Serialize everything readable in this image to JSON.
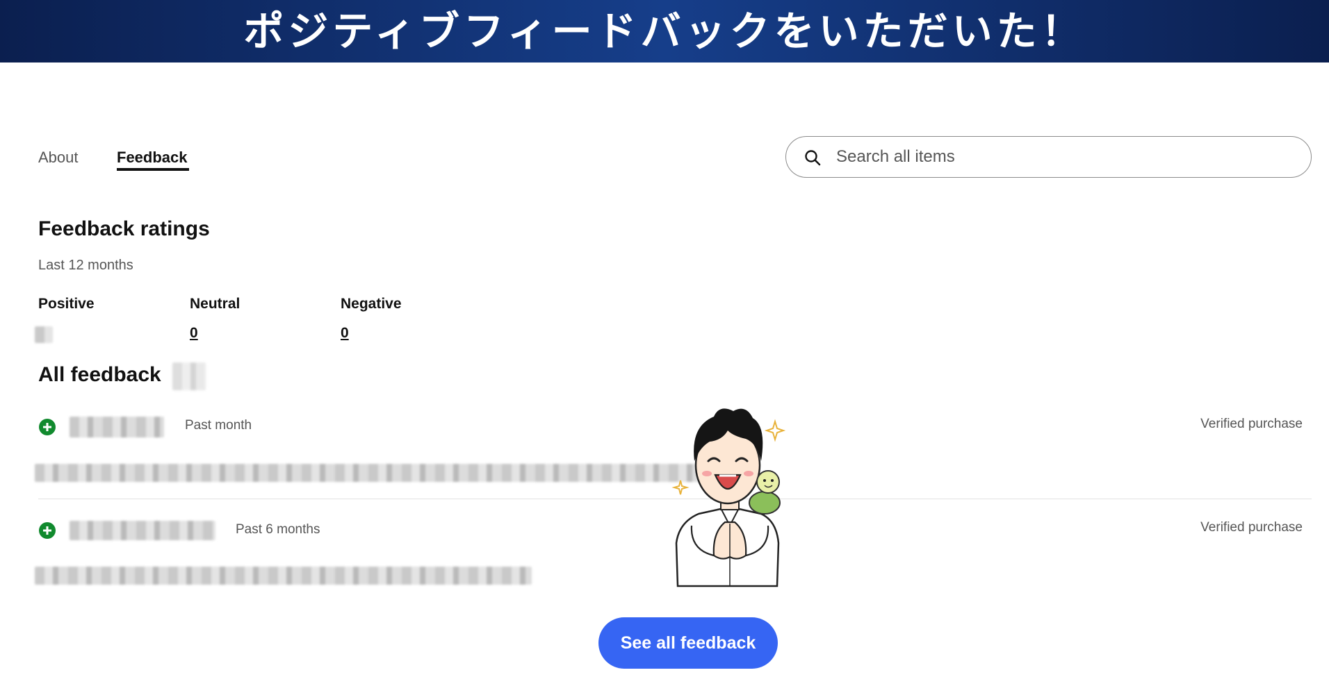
{
  "banner": {
    "title": "ポジティブフィードバックをいただいた！"
  },
  "tabs": [
    {
      "label": "About",
      "active": false
    },
    {
      "label": "Feedback",
      "active": true
    }
  ],
  "search": {
    "placeholder": "Search all items",
    "value": ""
  },
  "ratings": {
    "title": "Feedback ratings",
    "period": "Last 12 months",
    "positive": {
      "label": "Positive",
      "value": ""
    },
    "neutral": {
      "label": "Neutral",
      "value": "0"
    },
    "negative": {
      "label": "Negative",
      "value": "0"
    }
  },
  "all_feedback": {
    "title": "All feedback",
    "entries": [
      {
        "rating": "positive",
        "time": "Past month",
        "badge": "Verified purchase"
      },
      {
        "rating": "positive",
        "time": "Past 6 months",
        "badge": "Verified purchase"
      }
    ]
  },
  "see_all_button": {
    "label": "See all feedback"
  },
  "colors": {
    "accent": "#3665f3",
    "positive": "#118a2e",
    "banner": "#0b1f4f"
  }
}
